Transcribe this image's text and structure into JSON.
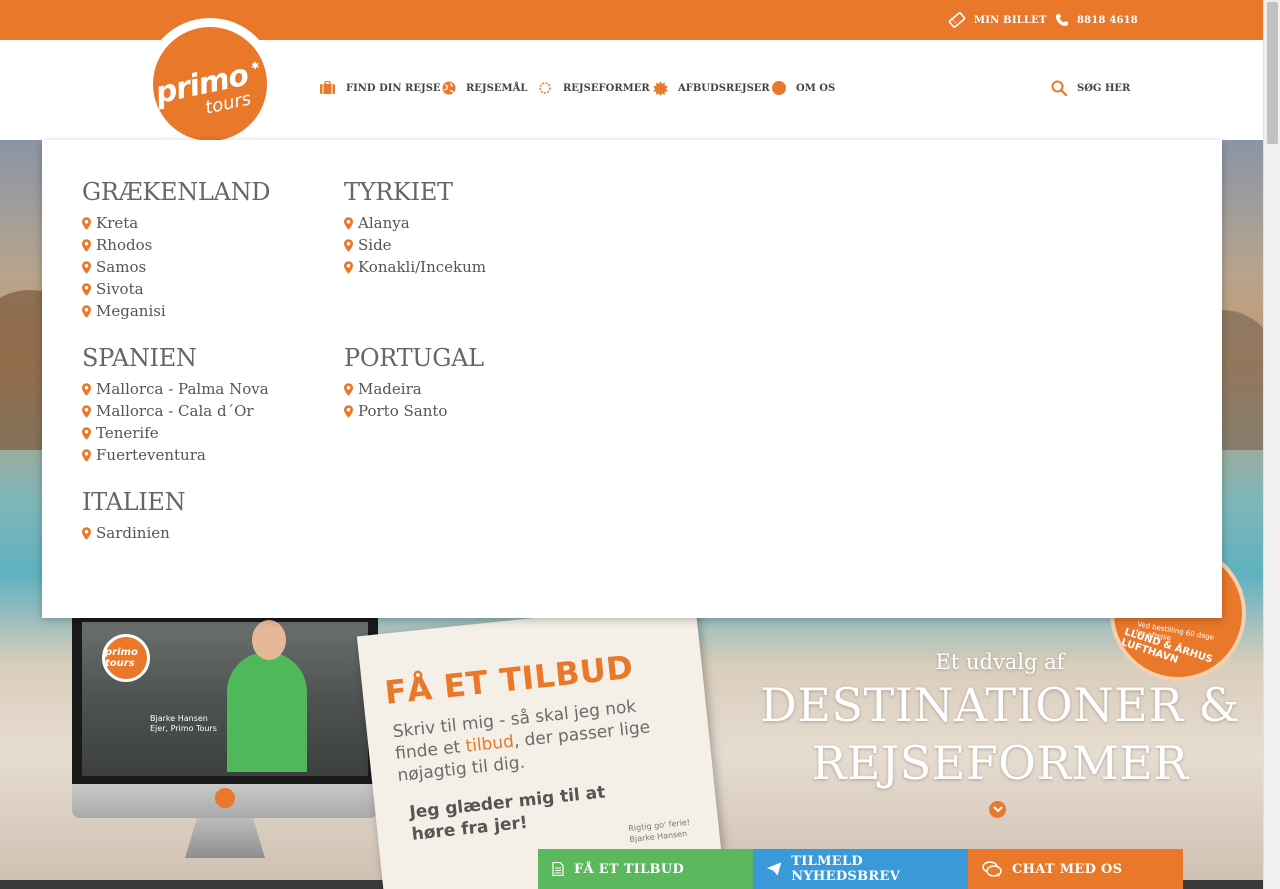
{
  "colors": {
    "accent": "#e9782a",
    "green": "#5cb85c",
    "blue": "#3a9ad9",
    "text": "#555555"
  },
  "topbar": {
    "ticket": {
      "icon": "ticket-icon",
      "label": "MIN BILLET"
    },
    "phone": {
      "icon": "phone-icon",
      "label": "8818 4618"
    }
  },
  "logo": {
    "primary": "primo",
    "secondary": "tours"
  },
  "nav": {
    "items": [
      {
        "icon": "suitcase-icon",
        "label": "FIND DIN REJSE"
      },
      {
        "icon": "globe-icon",
        "label": "REJSEMÅL"
      },
      {
        "icon": "sun-icon",
        "label": "REJSEFORMER"
      },
      {
        "icon": "burst-icon",
        "label": "AFBUDSREJSER"
      },
      {
        "icon": "circle-icon",
        "label": "OM OS"
      }
    ],
    "search": {
      "icon": "search-icon",
      "label": "SØG HER"
    }
  },
  "dropdown": {
    "groups": [
      {
        "title": "GRÆKENLAND",
        "items": [
          "Kreta",
          "Rhodos",
          "Samos",
          "Sivota",
          "Meganisi"
        ]
      },
      {
        "title": "TYRKIET",
        "items": [
          "Alanya",
          "Side",
          "Konakli/Incekum"
        ]
      },
      {
        "title": "SPANIEN",
        "items": [
          "Mallorca - Palma Nova",
          "Mallorca - Cala d´Or",
          "Tenerife",
          "Fuerteventura"
        ]
      },
      {
        "title": "PORTUGAL",
        "items": [
          "Madeira",
          "Porto Santo"
        ]
      },
      {
        "title": "ITALIEN",
        "items": [
          "Sardinien"
        ]
      }
    ]
  },
  "video": {
    "logo": "primo tours",
    "caption_name": "Bjarke Hansen",
    "caption_role": "Ejer, Primo Tours"
  },
  "note": {
    "title": "FÅ ET TILBUD",
    "body_pre": "Skriv til mig - så skal jeg nok finde et ",
    "body_highlight": "tilbud",
    "body_post": ", der passer lige nøjagtig til dig.",
    "bold": "Jeg glæder mig til at høre fra jer!",
    "sign_line1": "Rigtig go' ferie!",
    "sign_line2": "Bjarke Hansen"
  },
  "hero": {
    "small": "Et udvalg af",
    "big_line1": "DESTINATIONER &",
    "big_line2": "REJSEFORMER"
  },
  "badge": {
    "line1": "Ved bestilling 60 dage",
    "line2": "før afrejse",
    "line3": "LLUND & ÅRHUS LUFTHAVN"
  },
  "cta": [
    {
      "icon": "document-icon",
      "label": "FÅ ET TILBUD",
      "color": "#5cb85c"
    },
    {
      "icon": "paper-plane-icon",
      "label": "TILMELD NYHEDSBREV",
      "color": "#3a9ad9"
    },
    {
      "icon": "chat-icon",
      "label": "CHAT MED OS",
      "color": "#e9782a"
    }
  ]
}
